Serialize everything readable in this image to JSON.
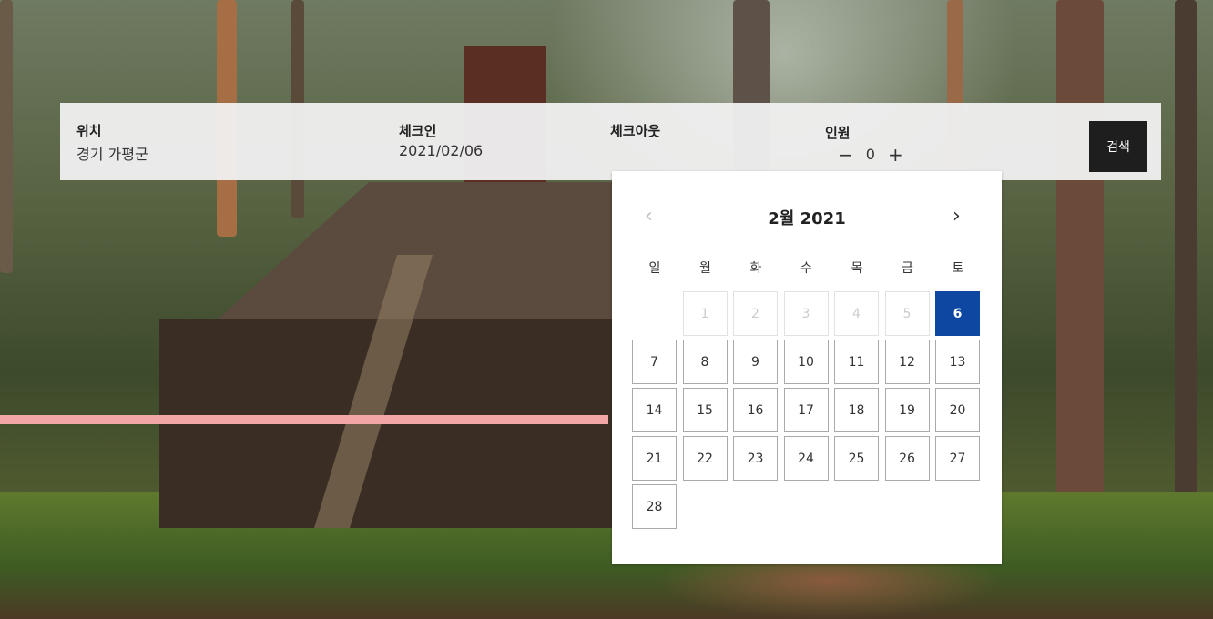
{
  "search": {
    "location": {
      "label": "위치",
      "value": "경기 가평군"
    },
    "checkin": {
      "label": "체크인",
      "value": "2021/02/06"
    },
    "checkout": {
      "label": "체크아웃",
      "value": ""
    },
    "guests": {
      "label": "인원",
      "count": "0",
      "minus": "−",
      "plus": "+"
    },
    "search_button": "검색"
  },
  "calendar": {
    "title": "2월 2021",
    "prev": "‹",
    "next": "›",
    "weekdays": [
      "일",
      "월",
      "화",
      "수",
      "목",
      "금",
      "토"
    ],
    "first_weekday_index": 1,
    "days_in_month": 28,
    "disabled_days": [
      1,
      2,
      3,
      4,
      5
    ],
    "selected_day": 6,
    "colors": {
      "selected": "#0d47a1"
    }
  }
}
